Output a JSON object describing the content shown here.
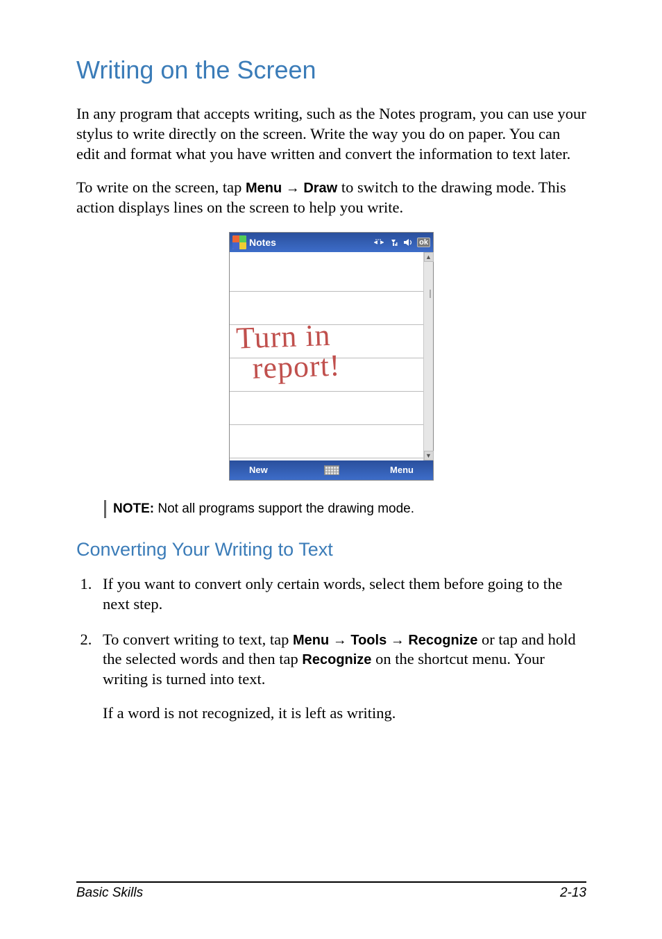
{
  "heading": "Writing on the Screen",
  "para1": "In any program that accepts writing, such as the Notes program, you can use your stylus to write directly on the screen. Write the way you do on paper. You can edit and format what you have written and convert the information to text later.",
  "para2_pre": "To write on the screen, tap ",
  "para2_menu": "Menu",
  "para2_arrow1": " → ",
  "para2_draw": "Draw",
  "para2_post": " to switch to the drawing mode. This action displays lines on the screen to help you write.",
  "device": {
    "title": "Notes",
    "ok": "ok",
    "handwriting_line1": "Turn in",
    "handwriting_line2": "report!",
    "bottom_left": "New",
    "bottom_right": "Menu"
  },
  "note_label": "NOTE:",
  "note_text": " Not all programs support the drawing mode.",
  "subheading": "Converting Your Writing to Text",
  "steps": {
    "s1": "If you want to convert only certain words, select them before going to the next step.",
    "s2_pre": "To convert writing to text, tap ",
    "s2_menu": "Menu",
    "s2_arr1": " → ",
    "s2_tools": "Tools",
    "s2_arr2": " → ",
    "s2_rec": "Recognize",
    "s2_mid": " or tap and hold the selected words and then tap ",
    "s2_rec2": "Recognize",
    "s2_post": " on the shortcut menu. Your writing is turned into text.",
    "s2_p2": "If a word is not recognized, it is left as writing."
  },
  "footer_left": "Basic Skills",
  "footer_right": "2-13"
}
